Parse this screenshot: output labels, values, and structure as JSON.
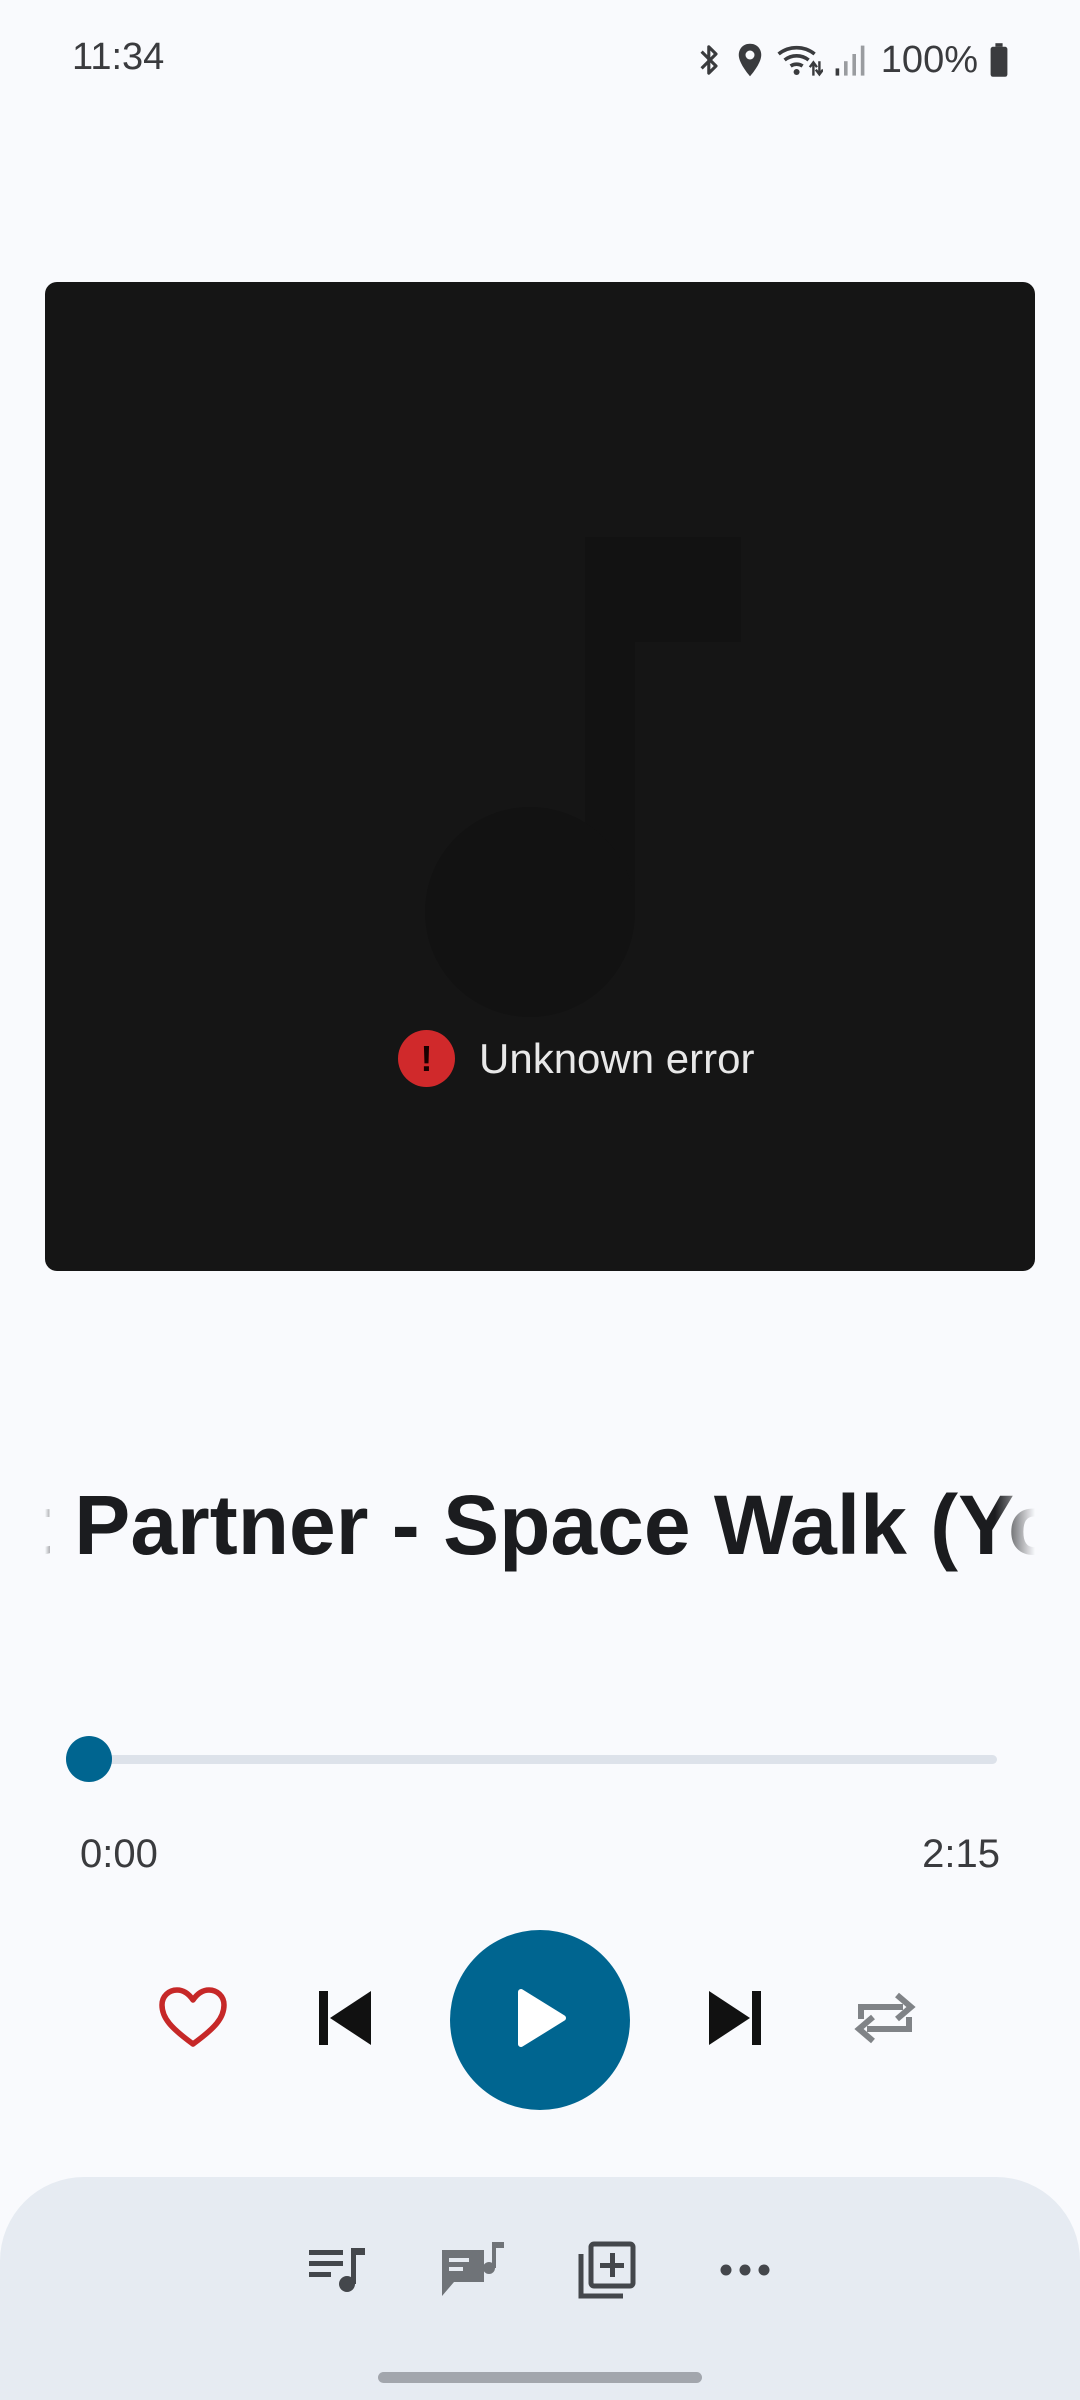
{
  "status_bar": {
    "time": "11:34",
    "battery": "100%",
    "icons": [
      "bluetooth-icon",
      "location-icon",
      "wifi-icon",
      "signal-icon",
      "battery-icon"
    ]
  },
  "artwork": {
    "placeholder_icon": "music-note-icon",
    "error_icon": "error-icon",
    "error_text": "Unknown error"
  },
  "track": {
    "title_visible": "t Partner - Space Walk (Yo"
  },
  "playback": {
    "current_time": "0:00",
    "total_time": "2:15",
    "progress_fraction": 0
  },
  "controls": {
    "like": "heart-icon",
    "previous": "skip-previous-icon",
    "play": "play-icon",
    "next": "skip-next-icon",
    "repeat": "repeat-icon"
  },
  "bottom_actions": {
    "items": [
      "queue-icon",
      "lyrics-icon",
      "add-to-playlist-icon",
      "more-icon"
    ]
  },
  "colors": {
    "accent": "#006590",
    "like": "#c62828",
    "artwork_bg": "#151515",
    "error": "#d0292b",
    "sheet_bg": "#e6ebf2"
  }
}
